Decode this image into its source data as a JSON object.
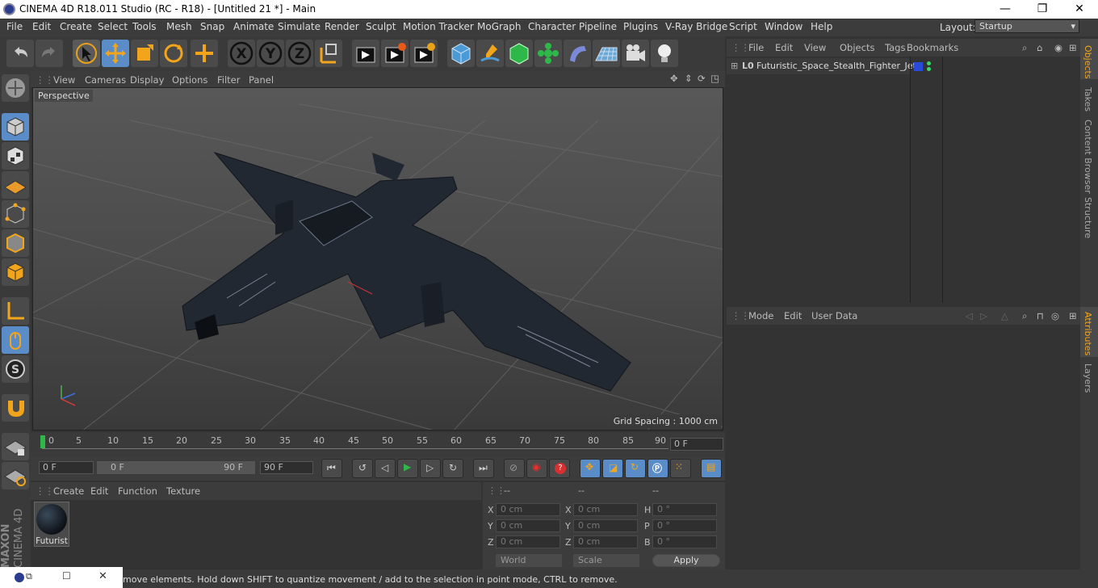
{
  "window": {
    "title": "CINEMA 4D R18.011 Studio (RC - R18) - [Untitled 21 *] - Main",
    "minimize": "—",
    "maximize": "❐",
    "close": "✕"
  },
  "menubar": {
    "items": [
      "File",
      "Edit",
      "Create",
      "Select",
      "Tools",
      "Mesh",
      "Snap",
      "Animate",
      "Simulate",
      "Render",
      "Sculpt",
      "Motion Tracker",
      "MoGraph",
      "Character",
      "Pipeline",
      "Plugins",
      "V-Ray Bridge",
      "Script",
      "Window",
      "Help"
    ],
    "layout_label": "Layout:",
    "layout_value": "Startup"
  },
  "viewport": {
    "menu": [
      "View",
      "Cameras",
      "Display",
      "Options",
      "Filter",
      "Panel"
    ],
    "camera_label": "Perspective",
    "grid_spacing": "Grid Spacing : 1000 cm"
  },
  "timeline": {
    "ticks": [
      "0",
      "5",
      "10",
      "15",
      "20",
      "25",
      "30",
      "35",
      "40",
      "45",
      "50",
      "55",
      "60",
      "65",
      "70",
      "75",
      "80",
      "85",
      "90"
    ],
    "current_frame": "0 F"
  },
  "transport": {
    "start_frame": "0 F",
    "range_start": "0 F",
    "range_end": "90 F",
    "end_frame": "90 F"
  },
  "materials": {
    "menu": [
      "Create",
      "Edit",
      "Function",
      "Texture"
    ],
    "items": [
      {
        "name": "Futurist"
      }
    ]
  },
  "coordinates": {
    "headers": [
      "--",
      "--",
      "--"
    ],
    "rows": [
      {
        "l1": "X",
        "v1": "0 cm",
        "l2": "X",
        "v2": "0 cm",
        "l3": "H",
        "v3": "0 °"
      },
      {
        "l1": "Y",
        "v1": "0 cm",
        "l2": "Y",
        "v2": "0 cm",
        "l3": "P",
        "v3": "0 °"
      },
      {
        "l1": "Z",
        "v1": "0 cm",
        "l2": "Z",
        "v2": "0 cm",
        "l3": "B",
        "v3": "0 °"
      }
    ],
    "world": "World",
    "scale": "Scale",
    "apply": "Apply"
  },
  "objects": {
    "menu": [
      "File",
      "Edit",
      "View",
      "Objects",
      "Tags",
      "Bookmarks"
    ],
    "items": [
      {
        "name": "Futuristic_Space_Stealth_Fighter_Jet",
        "layer": "L0"
      }
    ]
  },
  "attributes": {
    "menu": [
      "Mode",
      "Edit",
      "User Data"
    ]
  },
  "sidetabs": [
    "Objects",
    "Takes",
    "Content Browser",
    "Structure",
    "Attributes",
    "Layers"
  ],
  "status": {
    "text": "move elements. Hold down SHIFT to quantize movement / add to the selection in point mode, CTRL to remove."
  },
  "brand": {
    "text1": "MAXON",
    "text2": "CINEMA 4D"
  },
  "colors": {
    "accent": "#4a7ab8",
    "bg": "#333333",
    "active": "#5a8cc8"
  }
}
